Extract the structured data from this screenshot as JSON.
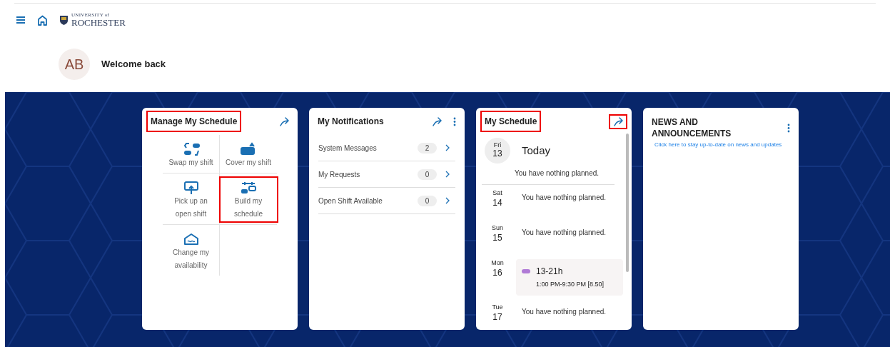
{
  "header": {
    "logo": {
      "line_1": "UNIVERSITY of",
      "line_2": "ROCHESTER"
    }
  },
  "welcome": {
    "initials": "AB",
    "text": "Welcome back"
  },
  "manage": {
    "title": "Manage My Schedule",
    "highlighted": true,
    "actions": [
      {
        "kind": "swap",
        "label": "Swap my shift",
        "highlighted": false
      },
      {
        "kind": "cover",
        "label": "Cover my shift",
        "highlighted": false
      },
      {
        "kind": "pickup",
        "label": "Pick up an open shift",
        "highlighted": false
      },
      {
        "kind": "build",
        "label": "Build my schedule",
        "highlighted": true
      },
      {
        "kind": "availability",
        "label": "Change my availability",
        "highlighted": false
      }
    ]
  },
  "notifications": {
    "title": "My Notifications",
    "items": [
      {
        "label": "System Messages",
        "count": "2"
      },
      {
        "label": "My Requests",
        "count": "0"
      },
      {
        "label": "Open Shift Available",
        "count": "0"
      }
    ]
  },
  "schedule": {
    "title": "My Schedule",
    "title_highlighted": true,
    "arrow_highlighted": true,
    "days": [
      {
        "kind": "today",
        "weekday": "Fri",
        "day": "13",
        "heading": "Today",
        "note": "You have nothing planned."
      },
      {
        "kind": "day",
        "weekday": "Sat",
        "day": "14",
        "note": "You have nothing planned."
      },
      {
        "kind": "day",
        "weekday": "Sun",
        "day": "15",
        "note": "You have nothing planned."
      },
      {
        "kind": "shift",
        "weekday": "Mon",
        "day": "16",
        "shift": {
          "name": "13-21h",
          "time": "1:00 PM-9:30 PM [8.50]",
          "color": "#b07ad6"
        }
      },
      {
        "kind": "day",
        "weekday": "Tue",
        "day": "17",
        "note": "You have nothing planned."
      }
    ]
  },
  "news": {
    "title": "NEWS AND ANNOUNCEMENTS",
    "link": "Click here to stay up-to-date on news and updates"
  }
}
